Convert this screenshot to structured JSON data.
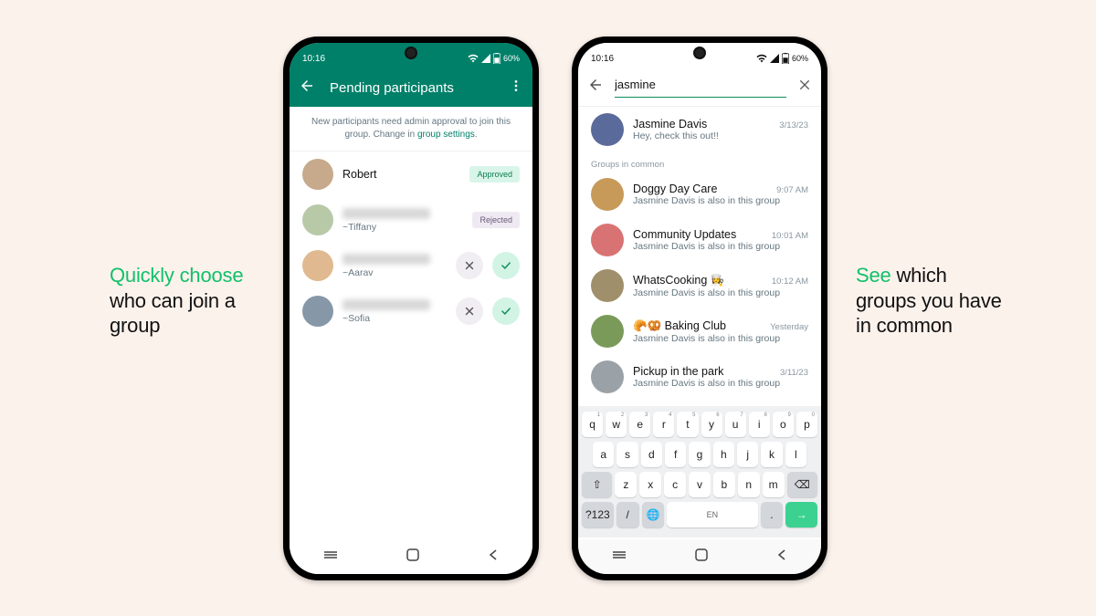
{
  "captions": {
    "left_accent": "Quickly choose",
    "left_rest": " who can join a group",
    "right_accent": "See",
    "right_rest": " which groups you have in common"
  },
  "status": {
    "time": "10:16",
    "battery": "60%"
  },
  "left_phone": {
    "title": "Pending participants",
    "notice_a": "New participants need admin approval to join this group. Change in ",
    "notice_link": "group settings",
    "notice_b": ".",
    "participants": [
      {
        "name": "Robert",
        "sub": "",
        "status": "Approved",
        "status_kind": "approved",
        "avatar": "#c7a98b"
      },
      {
        "name": "",
        "sub": "~Tiffany",
        "status": "Rejected",
        "status_kind": "rejected",
        "blurred": true,
        "avatar": "#b8c9a8"
      },
      {
        "name": "",
        "sub": "~Aarav",
        "status": "",
        "actions": true,
        "blurred": true,
        "avatar": "#e0b990"
      },
      {
        "name": "",
        "sub": "~Sofia",
        "status": "",
        "actions": true,
        "blurred": true,
        "avatar": "#8698a8"
      }
    ]
  },
  "right_phone": {
    "search_value": "jasmine",
    "top_result": {
      "name": "Jasmine Davis",
      "msg": "Hey, check this out!!",
      "time": "3/13/23",
      "avatar": "#5a6a9a"
    },
    "section": "Groups in common",
    "also_in": " is also in this group",
    "mention": "Jasmine Davis",
    "groups": [
      {
        "name": "Doggy Day Care",
        "time": "9:07 AM",
        "avatar": "#c79a5a"
      },
      {
        "name": "Community Updates",
        "time": "10:01 AM",
        "avatar": "#d97373"
      },
      {
        "name": "WhatsCooking 👩‍🍳",
        "time": "10:12 AM",
        "avatar": "#9f8f6a"
      },
      {
        "name": "🥐🥨 Baking Club",
        "time": "Yesterday",
        "avatar": "#7a9a5a"
      },
      {
        "name": "Pickup in the park",
        "time": "3/11/23",
        "avatar": "#9aa2a8"
      }
    ]
  },
  "keyboard": {
    "row1": [
      "q",
      "w",
      "e",
      "r",
      "t",
      "y",
      "u",
      "i",
      "o",
      "p"
    ],
    "sup1": [
      "1",
      "2",
      "3",
      "4",
      "5",
      "6",
      "7",
      "8",
      "9",
      "0"
    ],
    "row2": [
      "a",
      "s",
      "d",
      "f",
      "g",
      "h",
      "j",
      "k",
      "l"
    ],
    "row3": [
      "z",
      "x",
      "c",
      "v",
      "b",
      "n",
      "m"
    ],
    "shift": "⇧",
    "back": "⌫",
    "sym": "?123",
    "slash": "/",
    "globe": "🌐",
    "space": "EN",
    "dot": ".",
    "go": "→"
  }
}
